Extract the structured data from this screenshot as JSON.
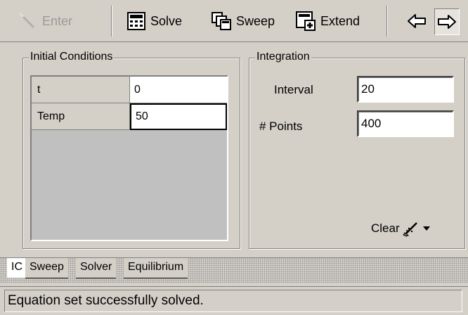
{
  "toolbar": {
    "enter_label": "Enter",
    "solve_label": "Solve",
    "sweep_label": "Sweep",
    "extend_label": "Extend",
    "back_icon": "arrow-left-icon",
    "forward_icon": "arrow-right-icon"
  },
  "initial_conditions": {
    "title": "Initial Conditions",
    "rows": [
      {
        "name": "t",
        "value": "0"
      },
      {
        "name": "Temp",
        "value": "50"
      }
    ]
  },
  "integration": {
    "title": "Integration",
    "interval_label": "Interval",
    "interval_value": "20",
    "points_label": "# Points",
    "points_value": "400",
    "clear_label": "Clear"
  },
  "tabs": [
    {
      "label": "IC",
      "active": true
    },
    {
      "label": "Sweep",
      "active": false
    },
    {
      "label": "Solver",
      "active": false
    },
    {
      "label": "Equilibrium",
      "active": false
    }
  ],
  "status": {
    "text": "Equation set successfully solved."
  },
  "colors": {
    "face": "#d4d0c8",
    "shadow": "#808080",
    "highlight": "#ffffff"
  }
}
